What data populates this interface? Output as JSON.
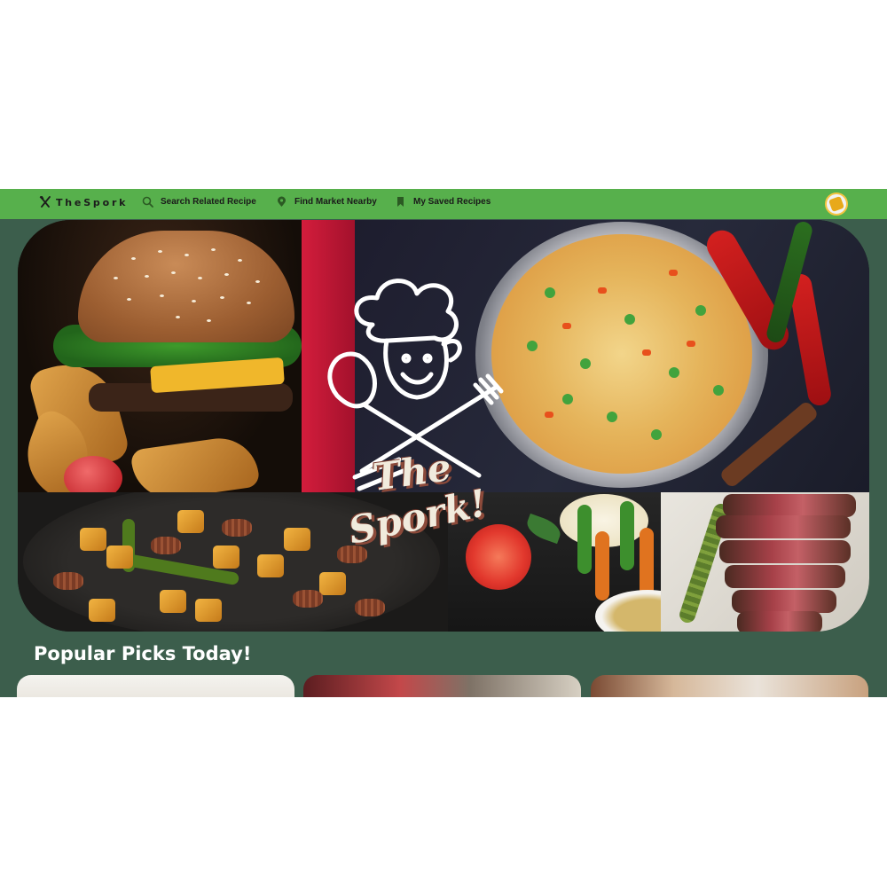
{
  "nav": {
    "brand": "TheSpork",
    "brand_icon": "fork-knife-icon",
    "items": [
      {
        "label": "Search Related Recipe",
        "icon": "search-icon"
      },
      {
        "label": "Find Market Nearby",
        "icon": "map-pin-icon"
      },
      {
        "label": "My Saved Recipes",
        "icon": "bookmark-icon"
      }
    ],
    "avatar_icon": "user-avatar-icon"
  },
  "hero": {
    "logo_line1": "The",
    "logo_line2": "Spork!"
  },
  "popular": {
    "title": "Popular Picks Today!",
    "cards": [
      {
        "image": "recipe-card-image-1"
      },
      {
        "image": "recipe-card-image-2"
      },
      {
        "image": "recipe-card-image-3"
      }
    ]
  },
  "colors": {
    "nav_bg": "#57b04c",
    "page_bg": "#3c5e4c",
    "accent": "#f5c542"
  }
}
